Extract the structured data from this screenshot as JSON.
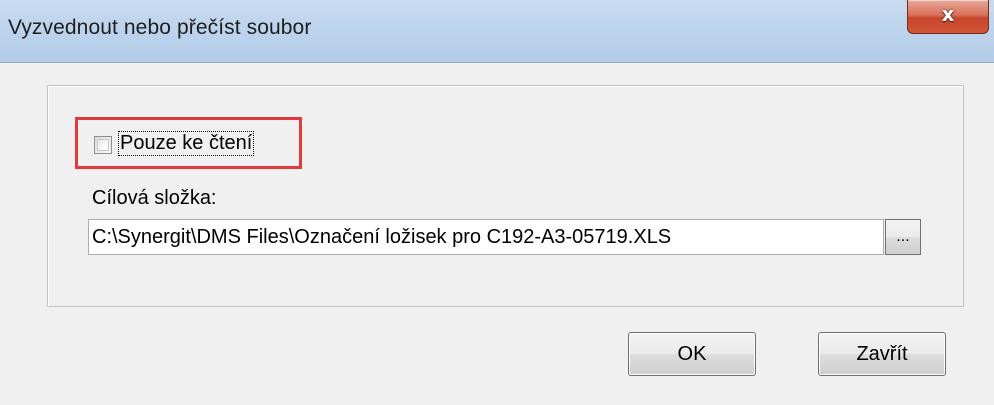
{
  "window": {
    "title": "Vyzvednout nebo přečíst soubor",
    "close_glyph": "x"
  },
  "readonly": {
    "label": "Pouze ke čtení",
    "checked": false
  },
  "target_folder": {
    "label": "Cílová složka:",
    "path": "C:\\Synergit\\DMS Files\\Označení ložisek pro C192-A3-05719.XLS",
    "browse_label": "..."
  },
  "buttons": {
    "ok_label": "OK",
    "close_label": "Zavřít"
  },
  "colors": {
    "highlight": "#e03a3a",
    "titlebar": "#bcd3ec",
    "close_button": "#c7462a"
  }
}
